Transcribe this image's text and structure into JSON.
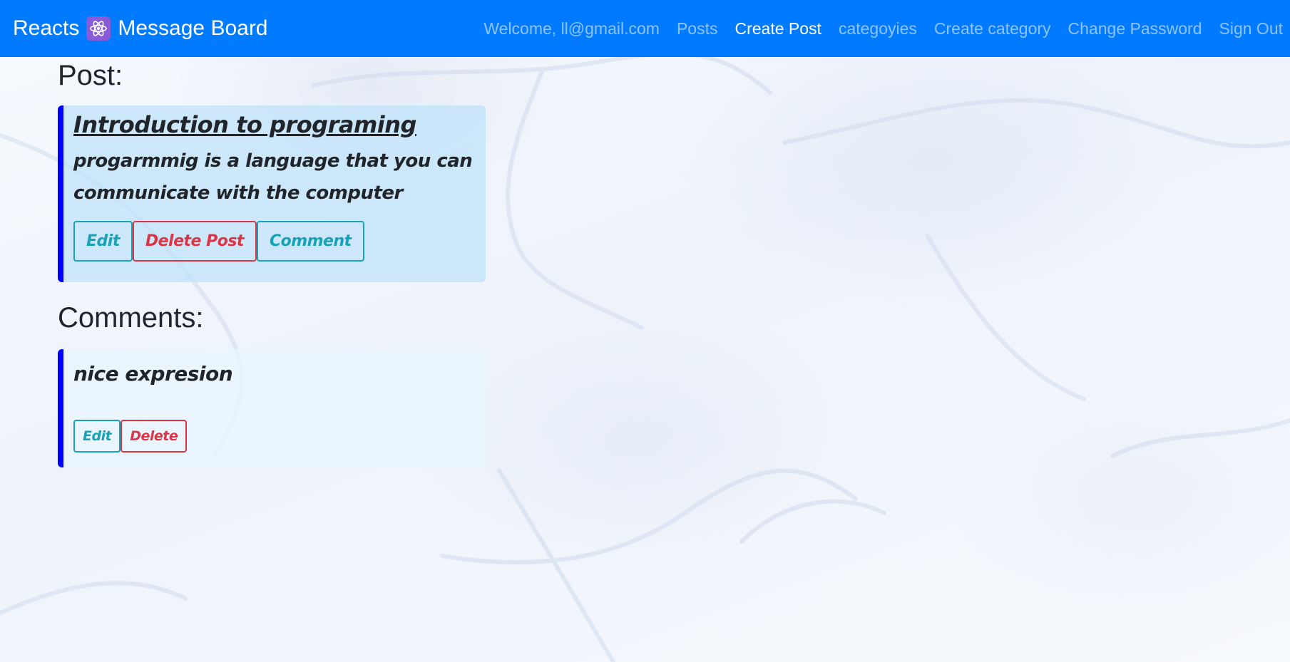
{
  "navbar": {
    "brand_prefix": "Reacts",
    "brand_suffix": "Message Board",
    "logo_icon": "react-atom-icon",
    "links": [
      {
        "label": "Welcome, ll@gmail.com",
        "active": false
      },
      {
        "label": "Posts",
        "active": false
      },
      {
        "label": "Create Post",
        "active": true
      },
      {
        "label": "categoyies",
        "active": false
      },
      {
        "label": "Create category",
        "active": false
      },
      {
        "label": "Change Password",
        "active": false
      },
      {
        "label": "Sign Out",
        "active": false
      }
    ],
    "background_color": "#007bff"
  },
  "post_section": {
    "heading": "Post:",
    "post": {
      "title": "Introduction to programing",
      "body": "progarmmig is a language that you can communicate with the computer",
      "buttons": {
        "edit": "Edit",
        "delete": "Delete Post",
        "comment": "Comment"
      }
    }
  },
  "comments_section": {
    "heading": "Comments:",
    "comments": [
      {
        "text": "nice expresion",
        "buttons": {
          "edit": "Edit",
          "delete": "Delete"
        }
      }
    ]
  },
  "colors": {
    "accent_border": "#0000ff",
    "info": "#17a2b8",
    "danger": "#dc3545"
  }
}
